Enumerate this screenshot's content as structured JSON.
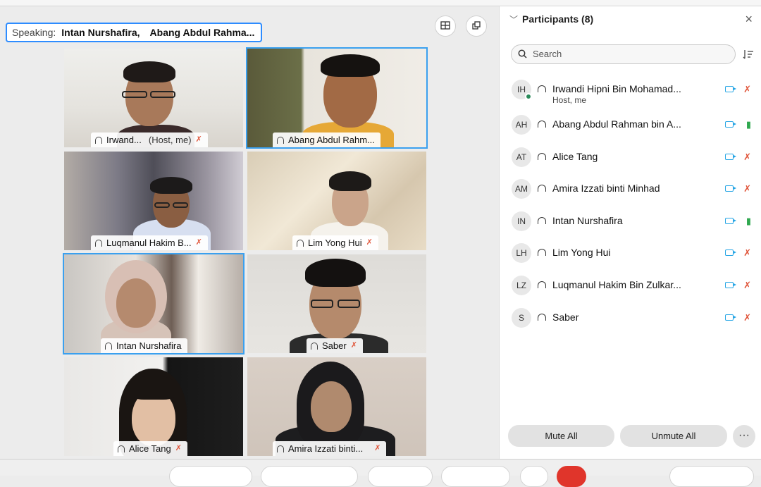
{
  "speaking": {
    "label": "Speaking:",
    "names": [
      "Intan Nurshafira,",
      "Abang Abdul Rahma..."
    ]
  },
  "toolbar_icons": [
    "gallery-grid-icon",
    "minimize-icon"
  ],
  "video_tiles": [
    {
      "name": "Irwand...",
      "suffix": "(Host, me)",
      "muted": true,
      "active": false
    },
    {
      "name": "Abang Abdul Rahm...",
      "suffix": "",
      "muted": false,
      "active": true
    },
    {
      "name": "Luqmanul Hakim B...",
      "suffix": "",
      "muted": true,
      "active": false
    },
    {
      "name": "Lim Yong Hui",
      "suffix": "",
      "muted": true,
      "active": false
    },
    {
      "name": "Intan Nurshafira",
      "suffix": "",
      "muted": false,
      "active": true
    },
    {
      "name": "Saber",
      "suffix": "",
      "muted": true,
      "active": false
    },
    {
      "name": "Alice Tang",
      "suffix": "",
      "muted": true,
      "active": false
    },
    {
      "name": "Amira Izzati binti...",
      "suffix": "",
      "muted": true,
      "active": false
    }
  ],
  "panel": {
    "title": "Participants (8)",
    "search_placeholder": "Search",
    "participants": [
      {
        "initials": "IH",
        "name": "Irwandi Hipni Bin Mohamad...",
        "sub": "Host, me",
        "mic": "off"
      },
      {
        "initials": "AH",
        "name": "Abang Abdul Rahman bin A...",
        "sub": "",
        "mic": "on"
      },
      {
        "initials": "AT",
        "name": "Alice Tang",
        "sub": "",
        "mic": "off"
      },
      {
        "initials": "AM",
        "name": "Amira Izzati binti Minhad",
        "sub": "",
        "mic": "off"
      },
      {
        "initials": "IN",
        "name": "Intan Nurshafira",
        "sub": "",
        "mic": "on"
      },
      {
        "initials": "LH",
        "name": "Lim Yong Hui",
        "sub": "",
        "mic": "off"
      },
      {
        "initials": "LZ",
        "name": "Luqmanul Hakim Bin Zulkar...",
        "sub": "",
        "mic": "off"
      },
      {
        "initials": "S",
        "name": "Saber",
        "sub": "",
        "mic": "off"
      }
    ],
    "mute_all": "Mute All",
    "unmute_all": "Unmute All",
    "more": "···"
  },
  "colors": {
    "accent": "#2d8cff",
    "active_border": "#3aa0ef",
    "muted": "#e0553a",
    "unmuted": "#2fa84f",
    "camera": "#27a6e5"
  }
}
